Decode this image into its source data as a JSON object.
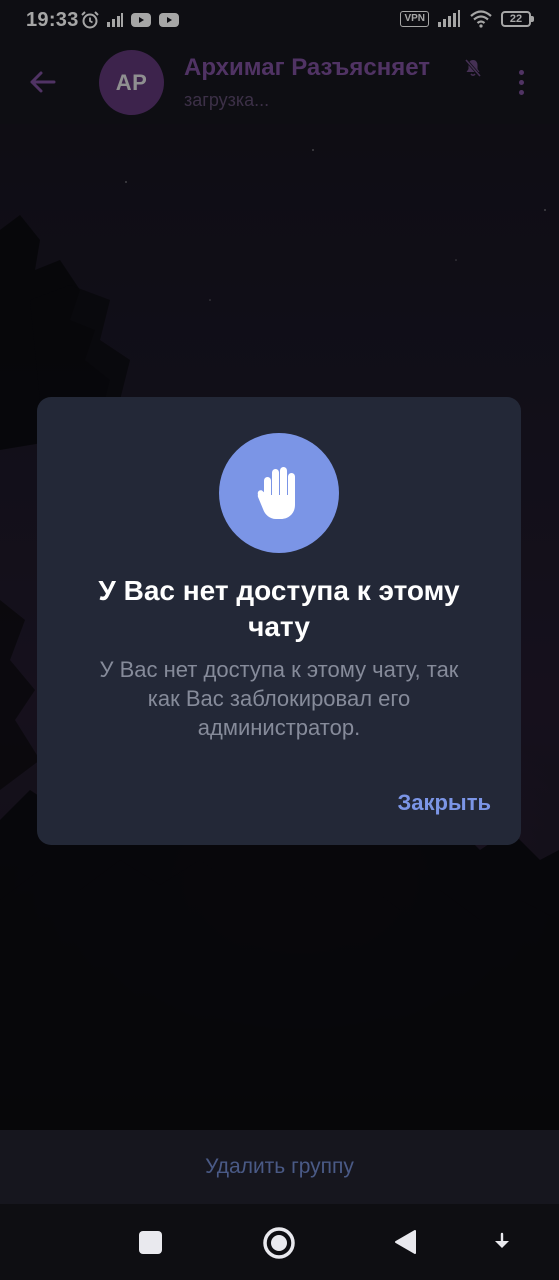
{
  "status_bar": {
    "time": "19:33",
    "vpn": "VPN",
    "battery": "22"
  },
  "header": {
    "avatar_initials": "AP",
    "title": "Архимаг Разъясняет",
    "subtitle": "загрузка..."
  },
  "dialog": {
    "title": "У Вас нет доступа к этому чату",
    "message": "У Вас нет доступа к этому чату, так как Вас заблокировал его администратор.",
    "close_label": "Закрыть",
    "icon": "raised-hand-icon"
  },
  "bottom_bar": {
    "delete_label": "Удалить группу"
  },
  "colors": {
    "accent": "#7b95e6",
    "dialog_bg": "#232837",
    "header_title": "#7c4f9a"
  }
}
